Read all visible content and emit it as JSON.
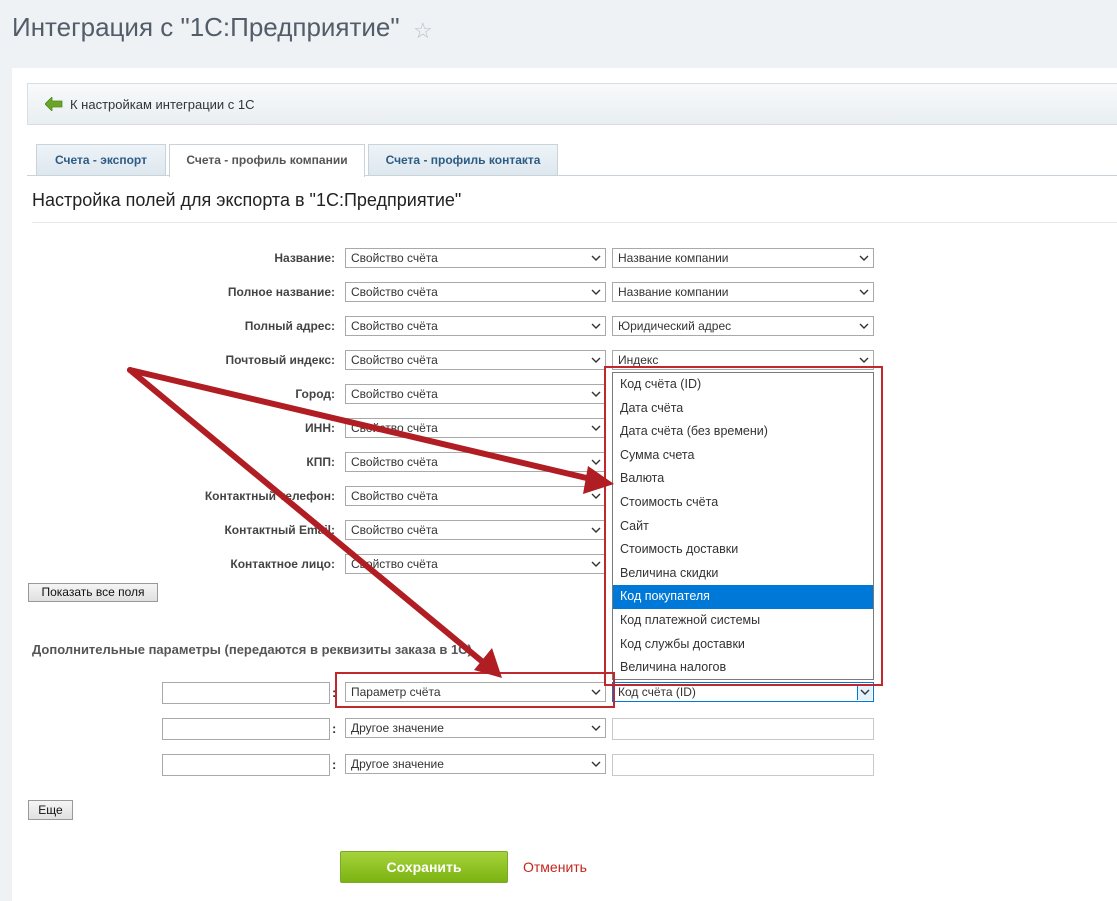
{
  "page": {
    "title": "Интеграция с \"1С:Предприятие\""
  },
  "back": {
    "label": "К настройкам интеграции с 1С"
  },
  "tabs": [
    {
      "label": "Счета - экспорт"
    },
    {
      "label": "Счета - профиль компании"
    },
    {
      "label": "Счета - профиль контакта"
    }
  ],
  "section": {
    "title": "Настройка полей для экспорта в \"1С:Предприятие\""
  },
  "fields": [
    {
      "label": "Название:",
      "source": "Свойство счёта",
      "value": "Название компании"
    },
    {
      "label": "Полное название:",
      "source": "Свойство счёта",
      "value": "Название компании"
    },
    {
      "label": "Полный адрес:",
      "source": "Свойство счёта",
      "value": "Юридический адрес"
    },
    {
      "label": "Почтовый индекс:",
      "source": "Свойство счёта",
      "value": "Индекс"
    },
    {
      "label": "Город:",
      "source": "Свойство счёта",
      "value": ""
    },
    {
      "label": "ИНН:",
      "source": "Свойство счёта",
      "value": ""
    },
    {
      "label": "КПП:",
      "source": "Свойство счёта",
      "value": ""
    },
    {
      "label": "Контактный телефон:",
      "source": "Свойство счёта",
      "value": ""
    },
    {
      "label": "Контактный Email:",
      "source": "Свойство счёта",
      "value": ""
    },
    {
      "label": "Контактное лицо:",
      "source": "Свойство счёта",
      "value": ""
    }
  ],
  "show_all_label": "Показать все поля",
  "extra": {
    "title": "Дополнительные параметры (передаются в реквизиты заказа в 1С)",
    "rows": [
      {
        "name": "",
        "source": "Параметр счёта",
        "value": "Код счёта (ID)"
      },
      {
        "name": "",
        "source": "Другое значение",
        "value": ""
      },
      {
        "name": "",
        "source": "Другое значение",
        "value": ""
      }
    ],
    "more_label": "Еще"
  },
  "dropdown": {
    "options": [
      "Код счёта (ID)",
      "Дата счёта",
      "Дата счёта (без времени)",
      "Сумма счета",
      "Валюта",
      "Стоимость счёта",
      "Сайт",
      "Стоимость доставки",
      "Величина скидки",
      "Код покупателя",
      "Код платежной системы",
      "Код службы доставки",
      "Величина налогов"
    ],
    "highlighted": "Код покупателя"
  },
  "actions": {
    "save": "Сохранить",
    "cancel": "Отменить"
  },
  "colors": {
    "accent_green": "#7cb312",
    "annotation_red": "#c0282d",
    "highlight_blue": "#0078d7"
  }
}
